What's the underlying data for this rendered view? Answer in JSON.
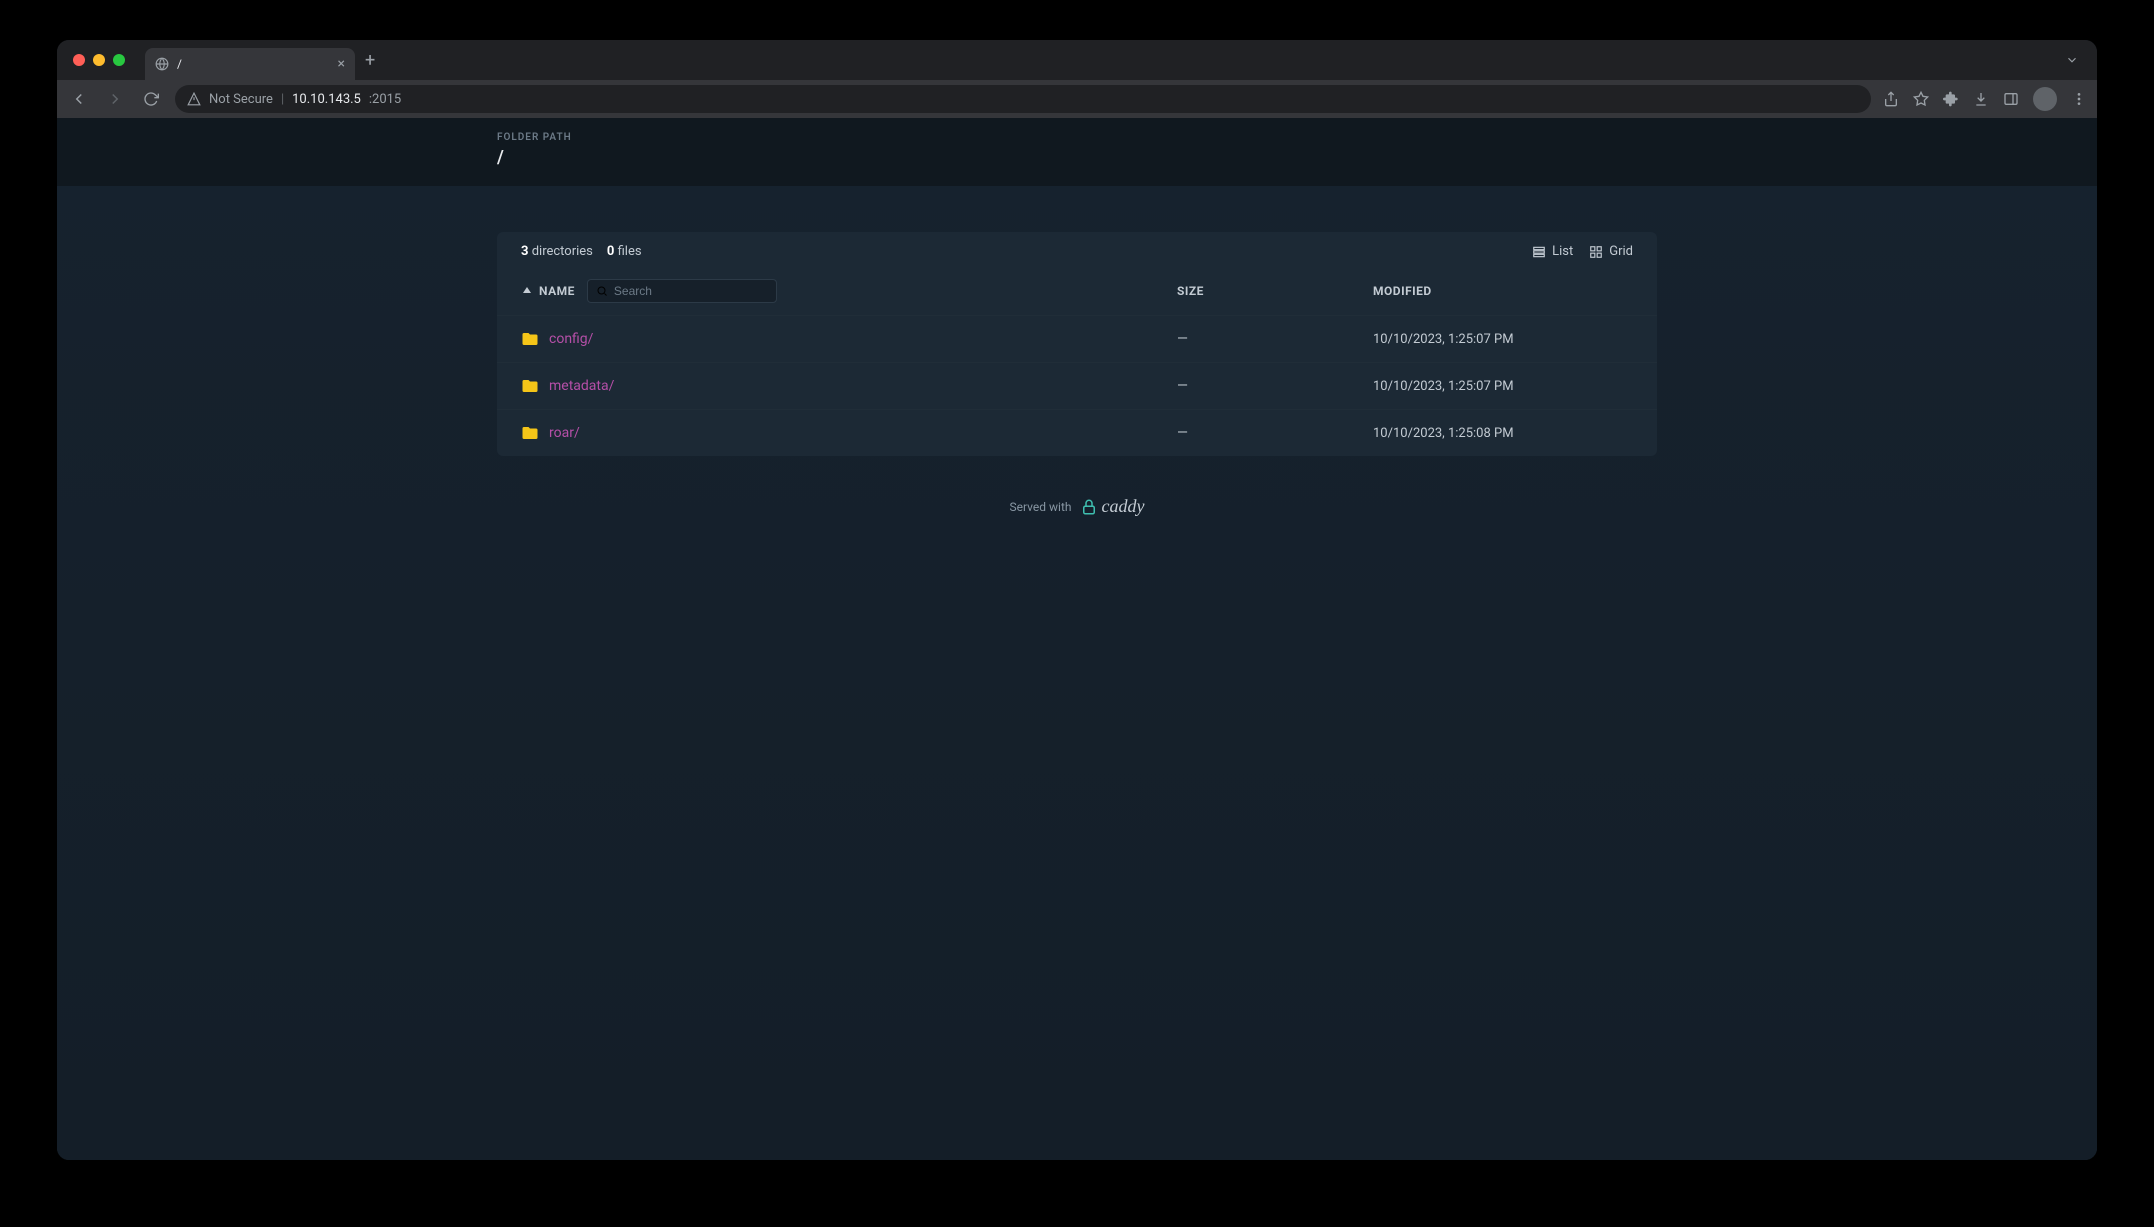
{
  "browser": {
    "tab_title": "/",
    "not_secure_label": "Not Secure",
    "url_host": "10.10.143.5",
    "url_port": ":2015"
  },
  "folder_path": {
    "label": "FOLDER PATH",
    "value": "/"
  },
  "counts": {
    "dirs_num": "3",
    "dirs_label": "directories",
    "files_num": "0",
    "files_label": "files"
  },
  "view": {
    "list_label": "List",
    "grid_label": "Grid"
  },
  "columns": {
    "name": "NAME",
    "size": "SIZE",
    "modified": "MODIFIED"
  },
  "search": {
    "placeholder": "Search"
  },
  "rows": [
    {
      "name": "config/",
      "size": "—",
      "modified": "10/10/2023, 1:25:07 PM"
    },
    {
      "name": "metadata/",
      "size": "—",
      "modified": "10/10/2023, 1:25:07 PM"
    },
    {
      "name": "roar/",
      "size": "—",
      "modified": "10/10/2023, 1:25:08 PM"
    }
  ],
  "footer": {
    "served_with": "Served with",
    "caddy": "caddy"
  }
}
